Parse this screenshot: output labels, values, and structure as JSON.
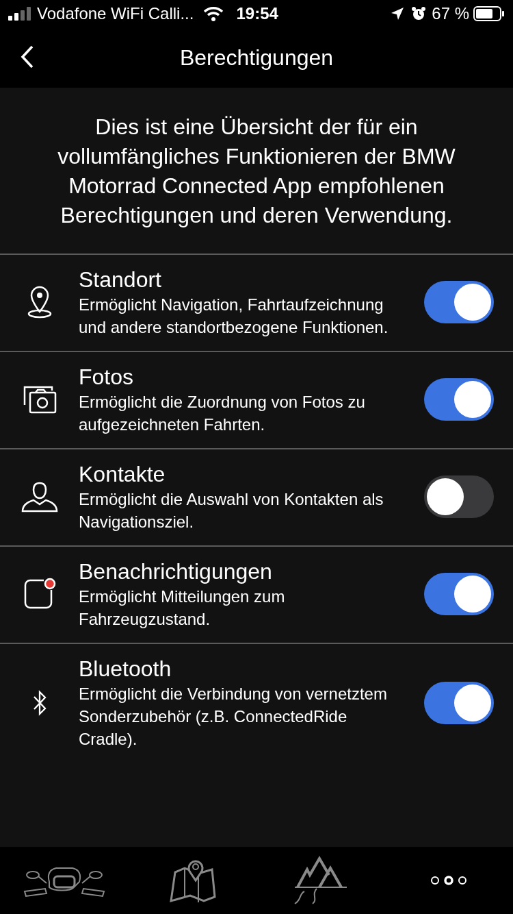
{
  "status_bar": {
    "carrier": "Vodafone WiFi Calli...",
    "time": "19:54",
    "battery": "67 %"
  },
  "header": {
    "title": "Berechtigungen"
  },
  "intro": "Dies ist eine Übersicht der für ein vollumfängliches Funktionieren der BMW Motorrad Connected App empfohlenen Berechtigungen und deren Verwendung.",
  "permissions": [
    {
      "kind": "location",
      "title": "Standort",
      "description": "Ermöglicht Navigation, Fahrtaufzeichnung und andere standortbezogene Funktionen.",
      "on": true
    },
    {
      "kind": "photos",
      "title": "Fotos",
      "description": "Ermöglicht die Zuordnung von Fotos zu aufgezeichneten Fahrten.",
      "on": true
    },
    {
      "kind": "contacts",
      "title": "Kontakte",
      "description": "Ermöglicht die Auswahl von Kontakten als Navigationsziel.",
      "on": false
    },
    {
      "kind": "notifications",
      "title": "Benachrichtigungen",
      "description": "Ermöglicht Mitteilungen zum Fahrzeugzustand.",
      "on": true
    },
    {
      "kind": "bluetooth",
      "title": "Bluetooth",
      "description": "Ermöglicht die Verbindung von vernetztem Sonderzubehör (z.B. ConnectedRide Cradle).",
      "on": true
    }
  ],
  "tabs": [
    {
      "kind": "bike",
      "selected": false
    },
    {
      "kind": "map",
      "selected": false
    },
    {
      "kind": "routes",
      "selected": false
    },
    {
      "kind": "more",
      "selected": true
    }
  ]
}
